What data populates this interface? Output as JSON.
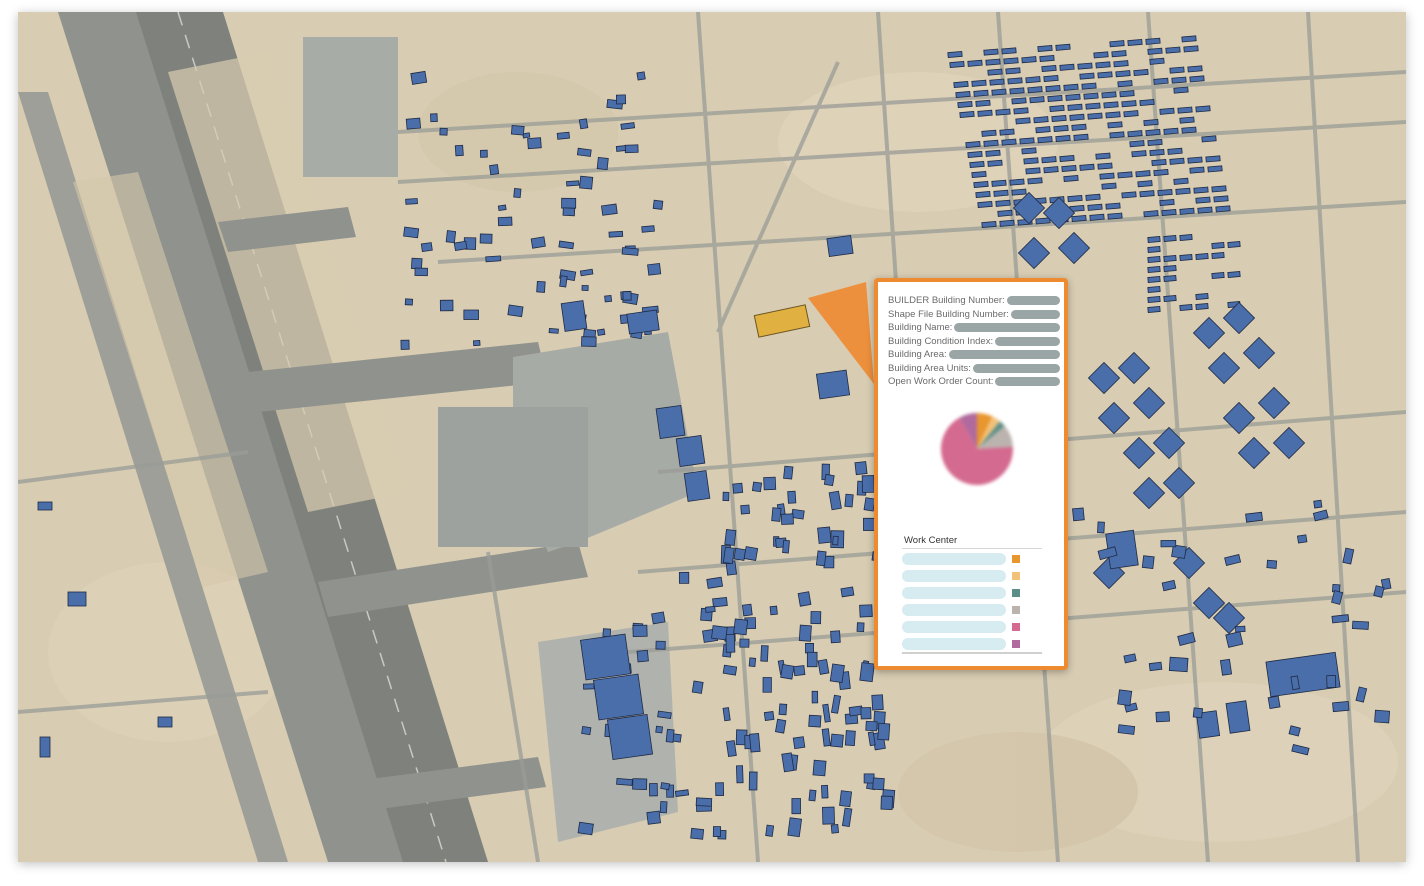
{
  "map": {
    "description_icon": "satellite-map",
    "building_color": "#4a6eaa",
    "selected_building_color": "#e0b040",
    "callout_color": "#ee8a30"
  },
  "tooltip": {
    "fields": [
      {
        "label": "BUILDER Building Number:"
      },
      {
        "label": "Shape File Building Number:"
      },
      {
        "label": "Building Name:"
      },
      {
        "label": "Building Condition Index:"
      },
      {
        "label": "Building Area:"
      },
      {
        "label": "Building Area Units:"
      },
      {
        "label": "Open Work Order Count:"
      }
    ],
    "pie": {
      "slices": [
        {
          "color": "#e8962e",
          "fraction": 0.07
        },
        {
          "color": "#f3c17a",
          "fraction": 0.04
        },
        {
          "color": "#5c8f88",
          "fraction": 0.03
        },
        {
          "color": "#bbb3ae",
          "fraction": 0.1
        },
        {
          "color": "#d46a8f",
          "fraction": 0.68
        },
        {
          "color": "#b06a9e",
          "fraction": 0.08
        }
      ]
    },
    "work_center": {
      "header": "Work Center",
      "rows": [
        {
          "color": "#e8962e"
        },
        {
          "color": "#f3c17a"
        },
        {
          "color": "#5c8f88"
        },
        {
          "color": "#bbb3ae"
        },
        {
          "color": "#d46a8f"
        },
        {
          "color": "#b06a9e"
        }
      ]
    }
  }
}
